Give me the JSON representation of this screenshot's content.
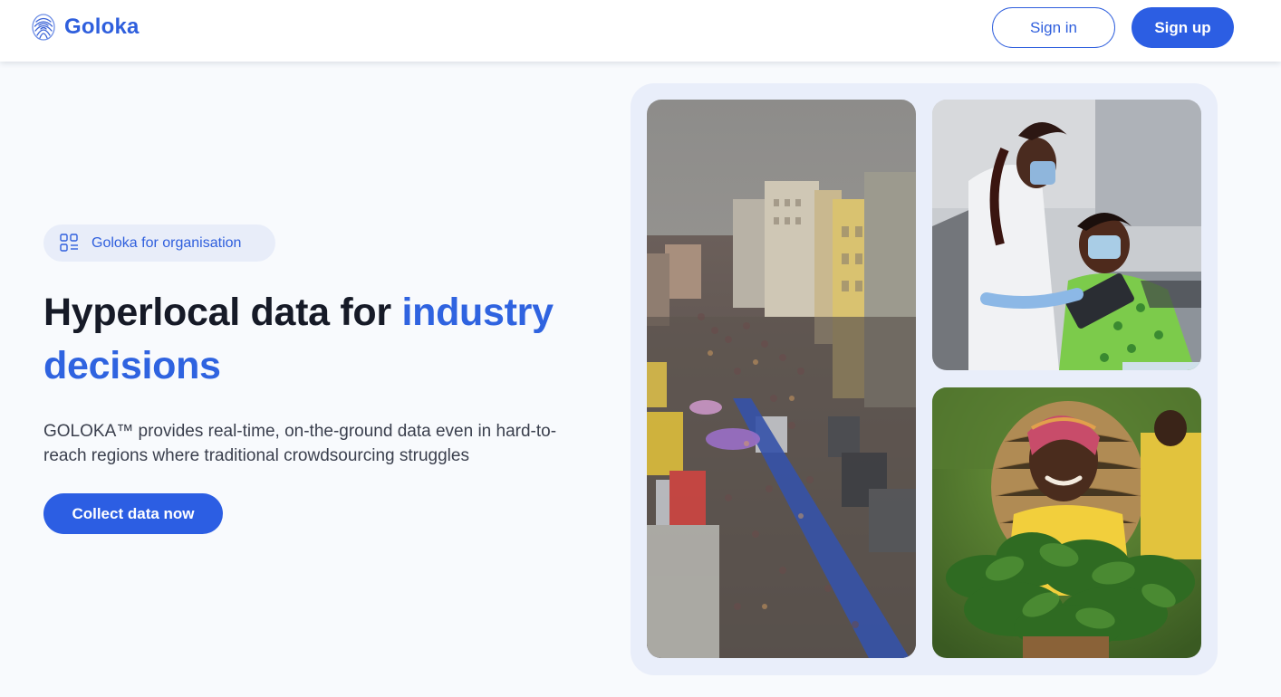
{
  "header": {
    "brand": "Goloka",
    "signin_label": "Sign in",
    "signup_label": "Sign up"
  },
  "hero": {
    "badge_label": "Goloka for organisation",
    "headline_part1": "Hyperlocal data for ",
    "headline_accent": "industry decisions",
    "description": "GOLOKA™ provides real-time, on-the-ground data even in hard-to-reach regions where traditional crowdsourcing struggles",
    "cta_label": "Collect data now"
  },
  "colors": {
    "primary": "#2c5ee3",
    "accent_text": "#2f63e0",
    "badge_bg": "#e8edf9",
    "gallery_bg": "#e9eefa",
    "page_bg": "#f8fafd"
  },
  "icons": {
    "logo": "fingerprint-globe-icon",
    "badge": "grid-apps-icon"
  }
}
